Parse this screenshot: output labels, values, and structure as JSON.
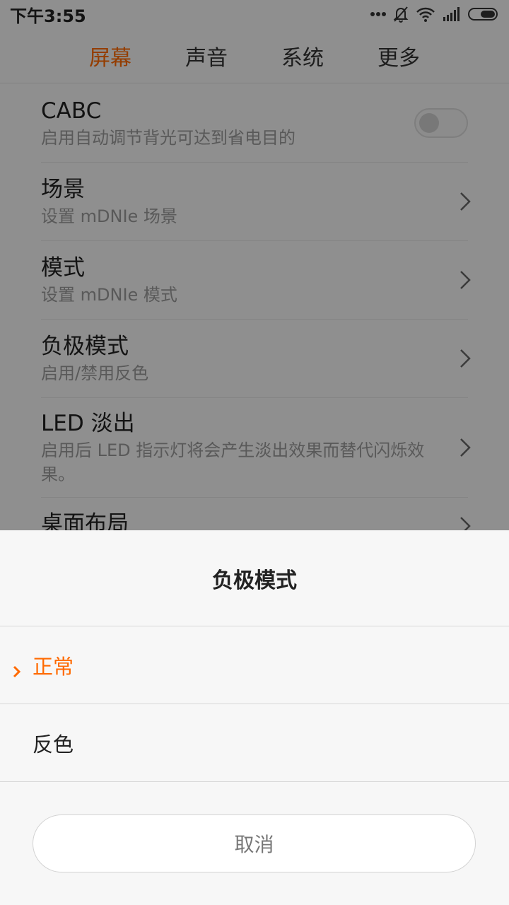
{
  "status_bar": {
    "time": "下午3:55",
    "icons": [
      "more-dots-icon",
      "bell-muted-icon",
      "wifi-icon",
      "signal-icon",
      "battery-icon"
    ]
  },
  "tabs": [
    {
      "label": "屏幕",
      "active": true
    },
    {
      "label": "声音",
      "active": false
    },
    {
      "label": "系统",
      "active": false
    },
    {
      "label": "更多",
      "active": false
    }
  ],
  "settings": [
    {
      "title": "CABC",
      "subtitle": "启用自动调节背光可达到省电目的",
      "control": "toggle",
      "toggle_on": false
    },
    {
      "title": "场景",
      "subtitle": "设置 mDNIe 场景",
      "control": "chevron-right-icon"
    },
    {
      "title": "模式",
      "subtitle": "设置 mDNIe 模式",
      "control": "chevron-right-icon"
    },
    {
      "title": "负极模式",
      "subtitle": "启用/禁用反色",
      "control": "chevron-right-icon"
    },
    {
      "title": "LED 淡出",
      "subtitle": "启用后 LED 指示灯将会产生淡出效果而替代闪烁效果。",
      "control": "chevron-right-icon"
    },
    {
      "title": "桌面布局",
      "subtitle": "",
      "control": "chevron-right-icon"
    }
  ],
  "dialog": {
    "title": "负极模式",
    "options": [
      {
        "label": "正常",
        "selected": true
      },
      {
        "label": "反色",
        "selected": false
      }
    ],
    "cancel_label": "取消"
  },
  "colors": {
    "accent": "#ff6a00",
    "text": "#222222",
    "subtext": "#9a9a9a",
    "background": "#f7f7f7"
  }
}
